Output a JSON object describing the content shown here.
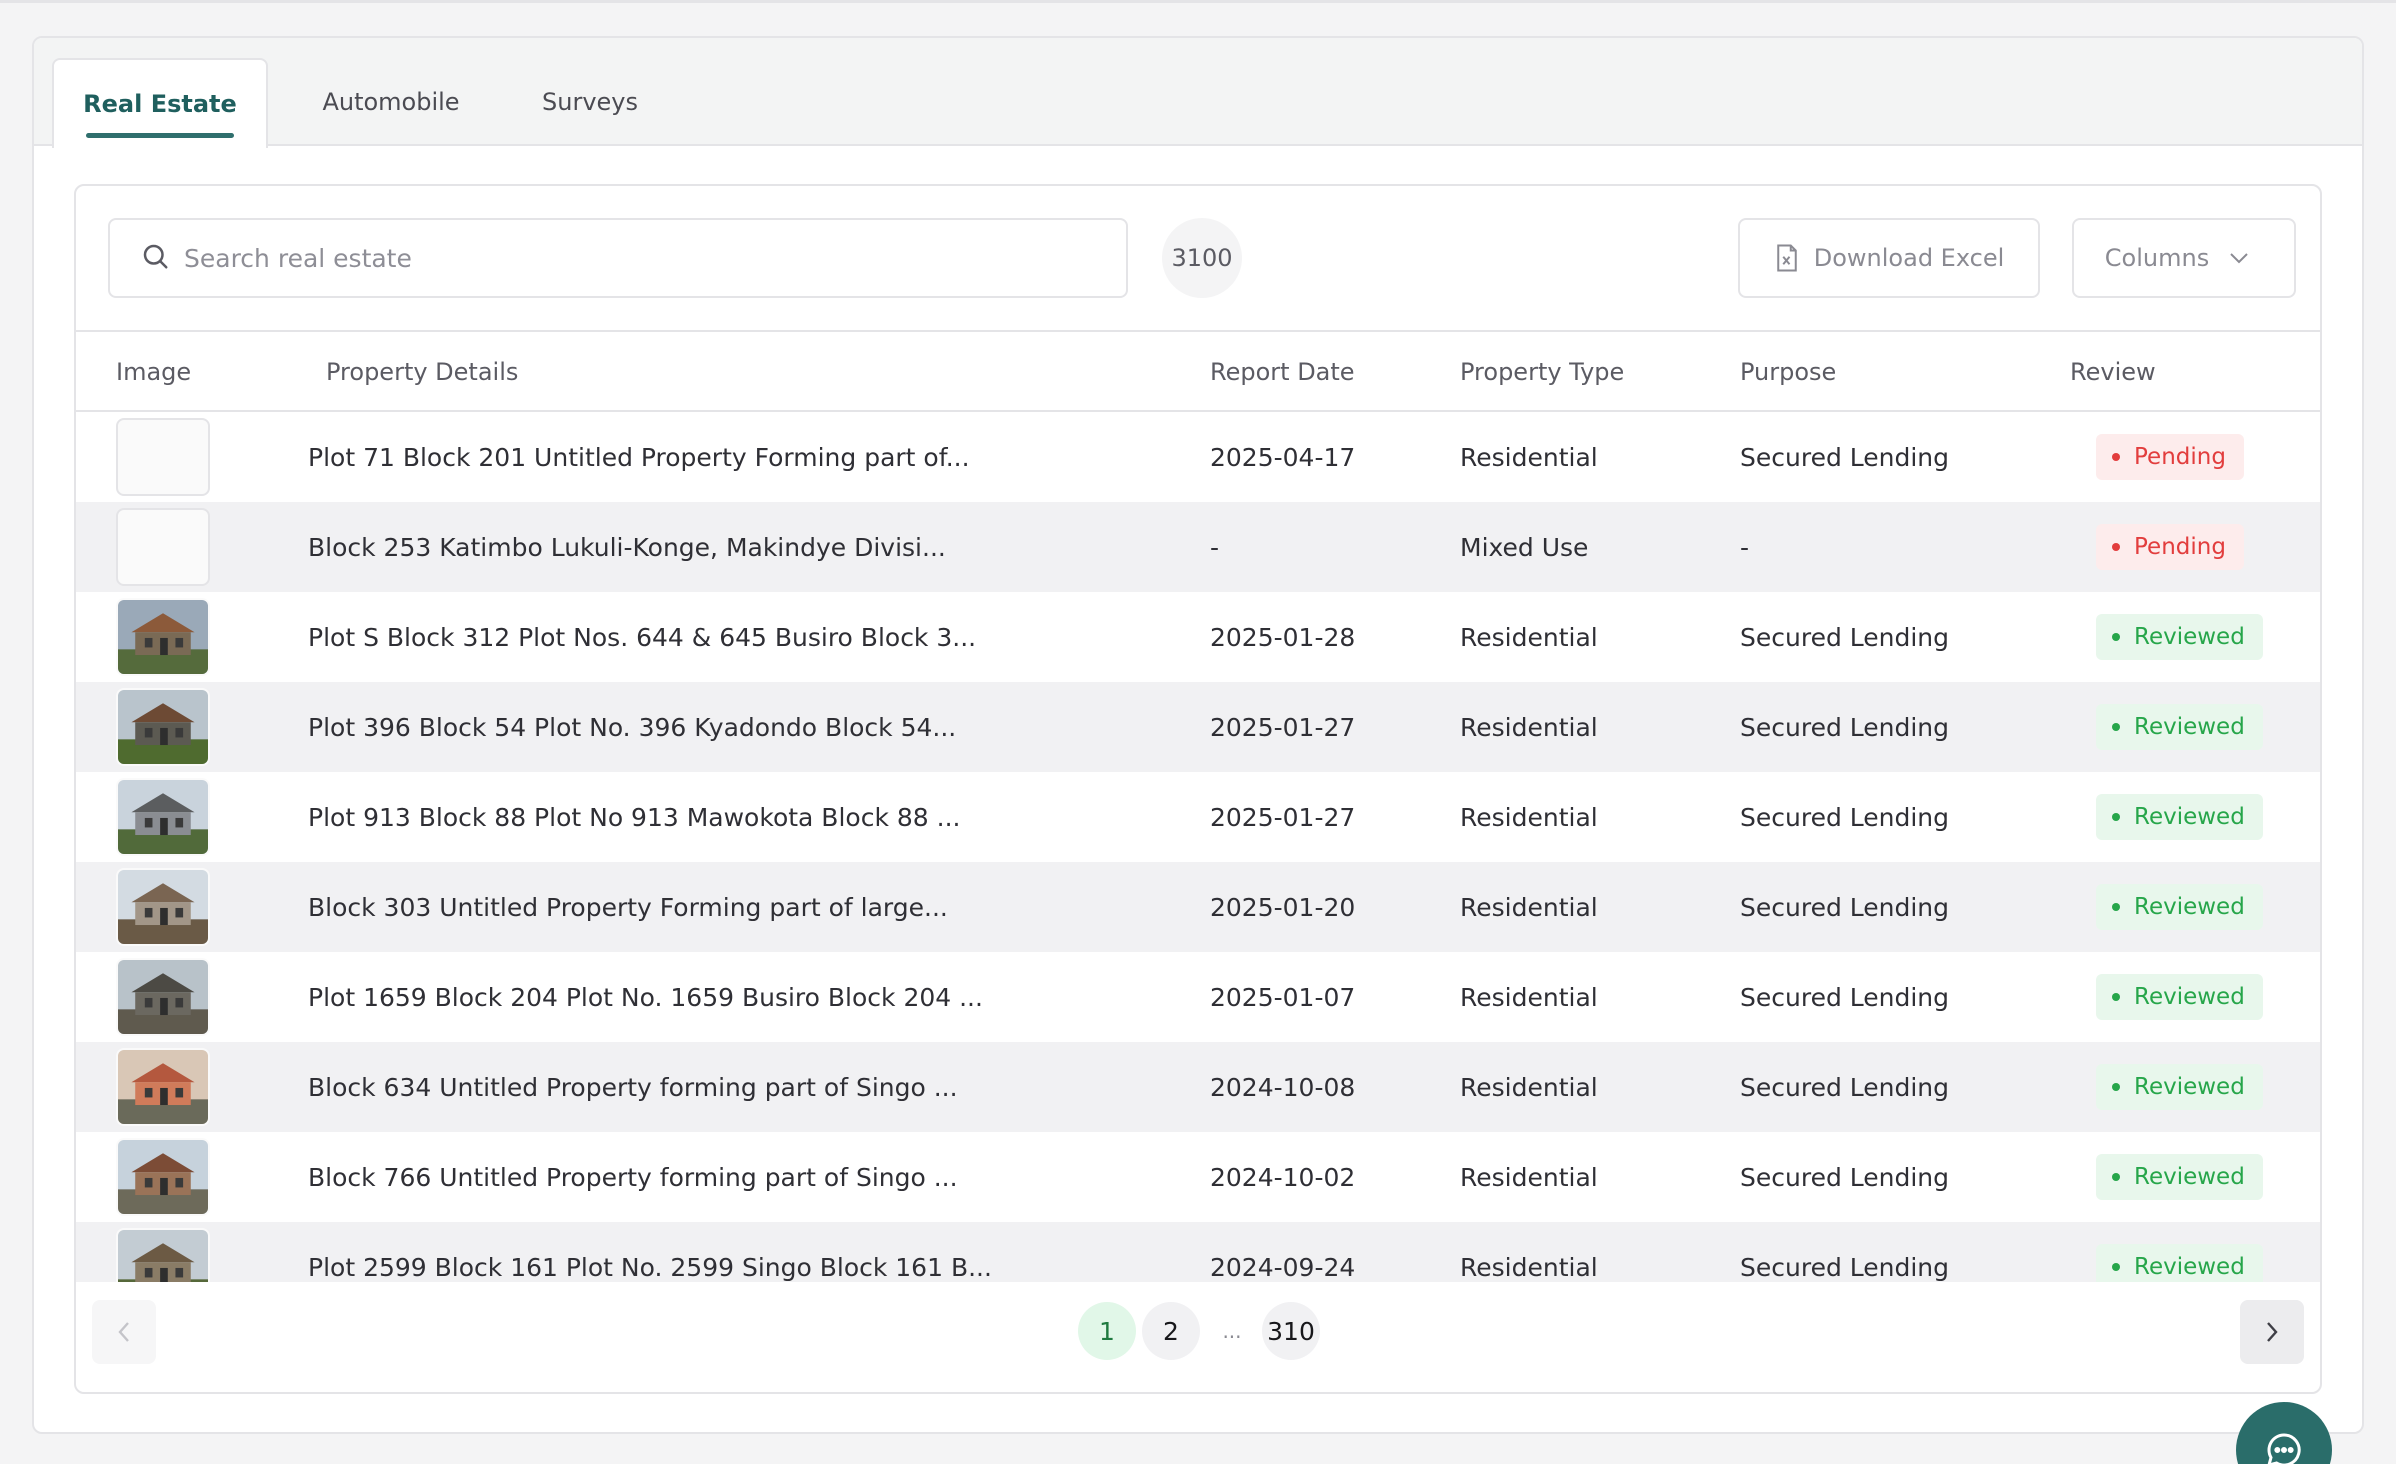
{
  "tabs": [
    {
      "label": "Real Estate",
      "active": true
    },
    {
      "label": "Automobile",
      "active": false
    },
    {
      "label": "Surveys",
      "active": false
    }
  ],
  "toolbar": {
    "search_placeholder": "Search real estate",
    "search_value": "",
    "count": "3100",
    "download_label": "Download Excel",
    "columns_label": "Columns"
  },
  "table": {
    "headers": {
      "image": "Image",
      "details": "Property Details",
      "date": "Report Date",
      "type": "Property Type",
      "purpose": "Purpose",
      "review": "Review"
    },
    "rows": [
      {
        "has_image": false,
        "details": "Plot 71 Block 201 Untitled Property Forming part of...",
        "date": "2025-04-17",
        "type": "Residential",
        "purpose": "Secured Lending",
        "review": "Pending"
      },
      {
        "has_image": false,
        "details": "Block 253 Katimbo Lukuli-Konge, Makindye Divisi...",
        "date": "-",
        "type": "Mixed Use",
        "purpose": "-",
        "review": "Pending"
      },
      {
        "has_image": true,
        "details": "Plot S Block 312 Plot Nos. 644 & 645 Busiro Block 3...",
        "date": "2025-01-28",
        "type": "Residential",
        "purpose": "Secured Lending",
        "review": "Reviewed"
      },
      {
        "has_image": true,
        "details": "Plot 396 Block 54 Plot No. 396 Kyadondo Block 54...",
        "date": "2025-01-27",
        "type": "Residential",
        "purpose": "Secured Lending",
        "review": "Reviewed"
      },
      {
        "has_image": true,
        "details": "Plot 913 Block 88 Plot No 913 Mawokota Block 88 ...",
        "date": "2025-01-27",
        "type": "Residential",
        "purpose": "Secured Lending",
        "review": "Reviewed"
      },
      {
        "has_image": true,
        "details": "Block 303 Untitled Property Forming part of large...",
        "date": "2025-01-20",
        "type": "Residential",
        "purpose": "Secured Lending",
        "review": "Reviewed"
      },
      {
        "has_image": true,
        "details": "Plot 1659 Block 204 Plot No. 1659 Busiro Block 204 ...",
        "date": "2025-01-07",
        "type": "Residential",
        "purpose": "Secured Lending",
        "review": "Reviewed"
      },
      {
        "has_image": true,
        "details": "Block 634 Untitled Property forming part of Singo ...",
        "date": "2024-10-08",
        "type": "Residential",
        "purpose": "Secured Lending",
        "review": "Reviewed"
      },
      {
        "has_image": true,
        "details": "Block 766 Untitled Property forming part of Singo ...",
        "date": "2024-10-02",
        "type": "Residential",
        "purpose": "Secured Lending",
        "review": "Reviewed"
      },
      {
        "has_image": true,
        "details": "Plot 2599 Block 161 Plot No. 2599 Singo Block 161 B...",
        "date": "2024-09-24",
        "type": "Residential",
        "purpose": "Secured Lending",
        "review": "Reviewed"
      }
    ]
  },
  "pagination": {
    "pages": [
      "1",
      "2",
      "310"
    ],
    "ellipsis": "...",
    "current": "1"
  },
  "colors": {
    "accent": "#2f6f6d",
    "pending": "#e23d3d",
    "reviewed": "#26a64a",
    "fab": "#2a6d6a"
  },
  "icons": [
    "search-icon",
    "excel-file-icon",
    "chevron-down-icon",
    "chevron-left-icon",
    "chevron-right-icon",
    "chat-icon"
  ]
}
